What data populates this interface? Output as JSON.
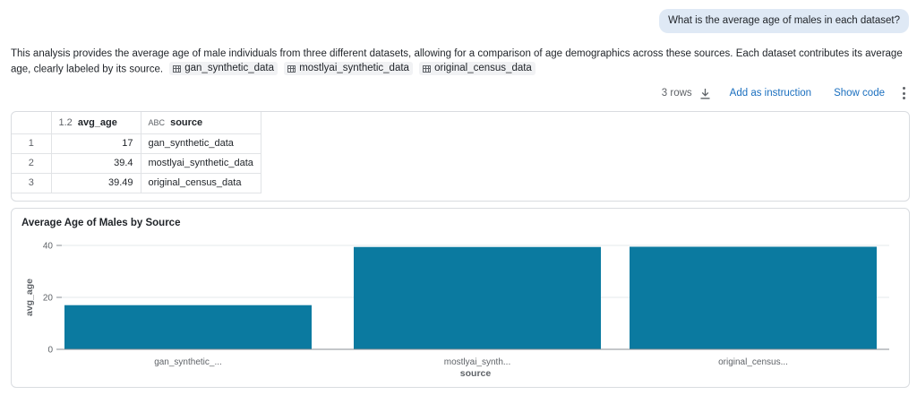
{
  "chat": {
    "question": "What is the average age of males in each dataset?"
  },
  "explanation": {
    "text": "This analysis provides the average age of male individuals from three different datasets, allowing for a comparison of age demographics across these sources. Each dataset contributes its average age, clearly labeled by its source.",
    "chips": [
      {
        "label": "gan_synthetic_data",
        "icon": "table-icon"
      },
      {
        "label": "mostlyai_synthetic_data",
        "icon": "table-icon"
      },
      {
        "label": "original_census_data",
        "icon": "table-icon"
      }
    ]
  },
  "toolbar": {
    "rows_label": "3 rows",
    "download_icon": "download-icon",
    "add_instruction_label": "Add as instruction",
    "show_code_label": "Show code",
    "more_icon": "more-vertical-icon"
  },
  "table": {
    "columns": [
      {
        "type_badge": "1.2",
        "name": "avg_age"
      },
      {
        "type_badge": "ABC",
        "name": "source"
      }
    ],
    "rows": [
      {
        "index": "1",
        "avg_age": "17",
        "source": "gan_synthetic_data"
      },
      {
        "index": "2",
        "avg_age": "39.4",
        "source": "mostlyai_synthetic_data"
      },
      {
        "index": "3",
        "avg_age": "39.49",
        "source": "original_census_data"
      }
    ]
  },
  "chart_data": {
    "type": "bar",
    "title": "Average Age of Males by Source",
    "xlabel": "source",
    "ylabel": "avg_age",
    "categories": [
      "gan_synthetic_data",
      "mostlyai_synthetic_data",
      "original_census_data"
    ],
    "category_tick_labels": [
      "gan_synthetic_...",
      "mostlyai_synth...",
      "original_census..."
    ],
    "values": [
      17,
      39.4,
      39.49
    ],
    "ylim": [
      0,
      40
    ],
    "yticks": [
      "0",
      "20",
      "40"
    ],
    "grid": true,
    "bar_color": "#0b7aa0"
  }
}
